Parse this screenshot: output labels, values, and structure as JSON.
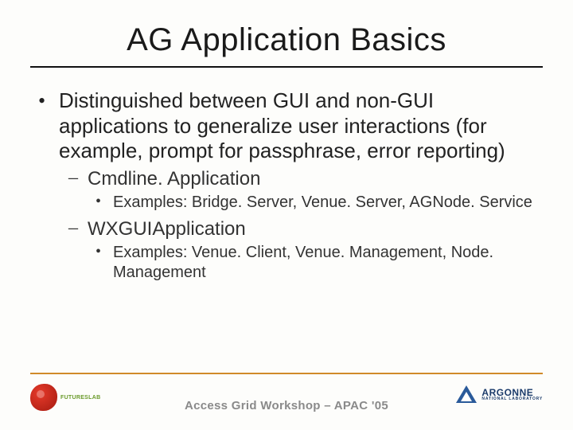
{
  "title": "AG Application Basics",
  "bullets": {
    "l1_text": "Distinguished between GUI and non-GUI applications to generalize user interactions (for example, prompt for passphrase, error reporting)",
    "sub1": {
      "label": "Cmdline. Application",
      "example": "Examples:  Bridge. Server, Venue. Server, AGNode. Service"
    },
    "sub2": {
      "label": "WXGUIApplication",
      "example": "Examples:  Venue. Client, Venue. Management, Node. Management"
    }
  },
  "footer": {
    "text": "Access Grid Workshop – APAC '05",
    "left_logo_label": "FUTURESLAB",
    "right_logo_big": "ARGONNE",
    "right_logo_small": "NATIONAL LABORATORY"
  }
}
